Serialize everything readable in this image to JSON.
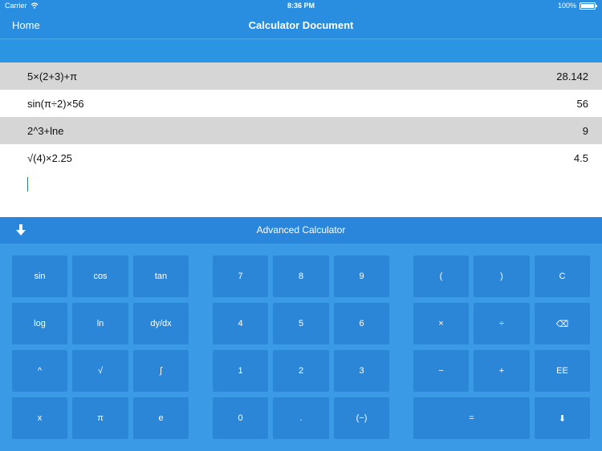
{
  "status_bar": {
    "carrier": "Carrier",
    "time": "8:36 PM",
    "battery": "100%"
  },
  "nav": {
    "home_label": "Home",
    "title": "Calculator Document"
  },
  "document": {
    "rows": [
      {
        "expression": "5×(2+3)+π",
        "result": "28.142"
      },
      {
        "expression": "sin(π÷2)×56",
        "result": "56"
      },
      {
        "expression": "2^3+lne",
        "result": "9"
      },
      {
        "expression": "√(4)×2.25",
        "result": "4.5"
      }
    ]
  },
  "calculator": {
    "title": "Advanced Calculator",
    "keys": {
      "sin": "sin",
      "cos": "cos",
      "tan": "tan",
      "log": "log",
      "ln": "ln",
      "dydx": "dy/dx",
      "pow": "^",
      "sqrt": "√",
      "integral": "∫",
      "x": "x",
      "pi": "π",
      "e": "e",
      "n7": "7",
      "n8": "8",
      "n9": "9",
      "n4": "4",
      "n5": "5",
      "n6": "6",
      "n1": "1",
      "n2": "2",
      "n3": "3",
      "n0": "0",
      "dot": ".",
      "neg": "(−)",
      "lparen": "(",
      "rparen": ")",
      "clear": "C",
      "mul": "×",
      "div": "÷",
      "backspace": "⌫",
      "minus": "−",
      "plus": "+",
      "ee": "EE",
      "equals": "=",
      "enter": "⬇"
    }
  },
  "colors": {
    "nav_bg": "#2a8ee0",
    "key_bg": "#2b86d8",
    "keypad_bg": "#3a9ae6",
    "row_shade": "#d6d6d6"
  }
}
